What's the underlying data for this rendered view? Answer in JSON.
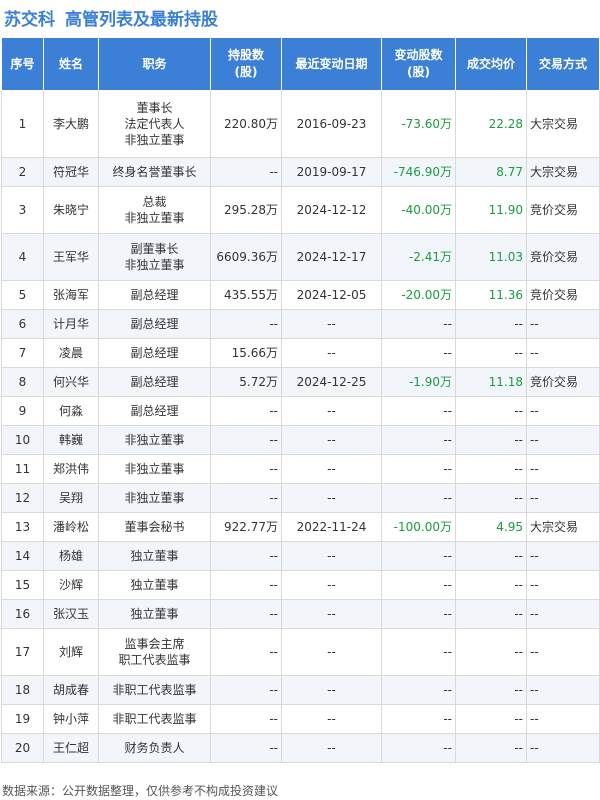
{
  "header": {
    "company": "苏交科",
    "title": "高管列表及最新持股"
  },
  "table": {
    "columns": [
      "序号",
      "姓名",
      "职务",
      "持股数\n(股)",
      "最近变动日期",
      "变动股数\n(股)",
      "成交均价",
      "交易方式"
    ],
    "rows": [
      {
        "no": "1",
        "name": "李大鹏",
        "position": [
          "董事长",
          "法定代表人",
          "非独立董事"
        ],
        "shares": "220.80万",
        "date": "2016-09-23",
        "change": "-73.60万",
        "price": "22.28",
        "method": "大宗交易"
      },
      {
        "no": "2",
        "name": "符冠华",
        "position": [
          "终身名誉董事长"
        ],
        "shares": "--",
        "date": "2019-09-17",
        "change": "-746.90万",
        "price": "8.77",
        "method": "大宗交易"
      },
      {
        "no": "3",
        "name": "朱晓宁",
        "position": [
          "总裁",
          "非独立董事"
        ],
        "shares": "295.28万",
        "date": "2024-12-12",
        "change": "-40.00万",
        "price": "11.90",
        "method": "竞价交易"
      },
      {
        "no": "4",
        "name": "王军华",
        "position": [
          "副董事长",
          "非独立董事"
        ],
        "shares": "6609.36万",
        "date": "2024-12-17",
        "change": "-2.41万",
        "price": "11.03",
        "method": "竞价交易"
      },
      {
        "no": "5",
        "name": "张海军",
        "position": [
          "副总经理"
        ],
        "shares": "435.55万",
        "date": "2024-12-05",
        "change": "-20.00万",
        "price": "11.36",
        "method": "竞价交易"
      },
      {
        "no": "6",
        "name": "计月华",
        "position": [
          "副总经理"
        ],
        "shares": "--",
        "date": "--",
        "change": "--",
        "price": "--",
        "method": "--"
      },
      {
        "no": "7",
        "name": "凌晨",
        "position": [
          "副总经理"
        ],
        "shares": "15.66万",
        "date": "--",
        "change": "--",
        "price": "--",
        "method": "--"
      },
      {
        "no": "8",
        "name": "何兴华",
        "position": [
          "副总经理"
        ],
        "shares": "5.72万",
        "date": "2024-12-25",
        "change": "-1.90万",
        "price": "11.18",
        "method": "竞价交易"
      },
      {
        "no": "9",
        "name": "何淼",
        "position": [
          "副总经理"
        ],
        "shares": "--",
        "date": "--",
        "change": "--",
        "price": "--",
        "method": "--"
      },
      {
        "no": "10",
        "name": "韩巍",
        "position": [
          "非独立董事"
        ],
        "shares": "--",
        "date": "--",
        "change": "--",
        "price": "--",
        "method": "--"
      },
      {
        "no": "11",
        "name": "郑洪伟",
        "position": [
          "非独立董事"
        ],
        "shares": "--",
        "date": "--",
        "change": "--",
        "price": "--",
        "method": "--"
      },
      {
        "no": "12",
        "name": "吴翔",
        "position": [
          "非独立董事"
        ],
        "shares": "--",
        "date": "--",
        "change": "--",
        "price": "--",
        "method": "--"
      },
      {
        "no": "13",
        "name": "潘岭松",
        "position": [
          "董事会秘书"
        ],
        "shares": "922.77万",
        "date": "2022-11-24",
        "change": "-100.00万",
        "price": "4.95",
        "method": "大宗交易"
      },
      {
        "no": "14",
        "name": "杨雄",
        "position": [
          "独立董事"
        ],
        "shares": "--",
        "date": "--",
        "change": "--",
        "price": "--",
        "method": "--"
      },
      {
        "no": "15",
        "name": "沙辉",
        "position": [
          "独立董事"
        ],
        "shares": "--",
        "date": "--",
        "change": "--",
        "price": "--",
        "method": "--"
      },
      {
        "no": "16",
        "name": "张汉玉",
        "position": [
          "独立董事"
        ],
        "shares": "--",
        "date": "--",
        "change": "--",
        "price": "--",
        "method": "--"
      },
      {
        "no": "17",
        "name": "刘辉",
        "position": [
          "监事会主席",
          "职工代表监事"
        ],
        "shares": "--",
        "date": "--",
        "change": "--",
        "price": "--",
        "method": "--"
      },
      {
        "no": "18",
        "name": "胡成春",
        "position": [
          "非职工代表监事"
        ],
        "shares": "--",
        "date": "--",
        "change": "--",
        "price": "--",
        "method": "--"
      },
      {
        "no": "19",
        "name": "钟小萍",
        "position": [
          "非职工代表监事"
        ],
        "shares": "--",
        "date": "--",
        "change": "--",
        "price": "--",
        "method": "--"
      },
      {
        "no": "20",
        "name": "王仁超",
        "position": [
          "财务负责人"
        ],
        "shares": "--",
        "date": "--",
        "change": "--",
        "price": "--",
        "method": "--"
      }
    ]
  },
  "footer": {
    "source": "数据来源：公开数据整理，仅供参考不构成投资建议"
  },
  "colors": {
    "accent": "#3b7fd6",
    "positive_green": "#1a9c3e",
    "row_alt": "#f2f6fb"
  }
}
